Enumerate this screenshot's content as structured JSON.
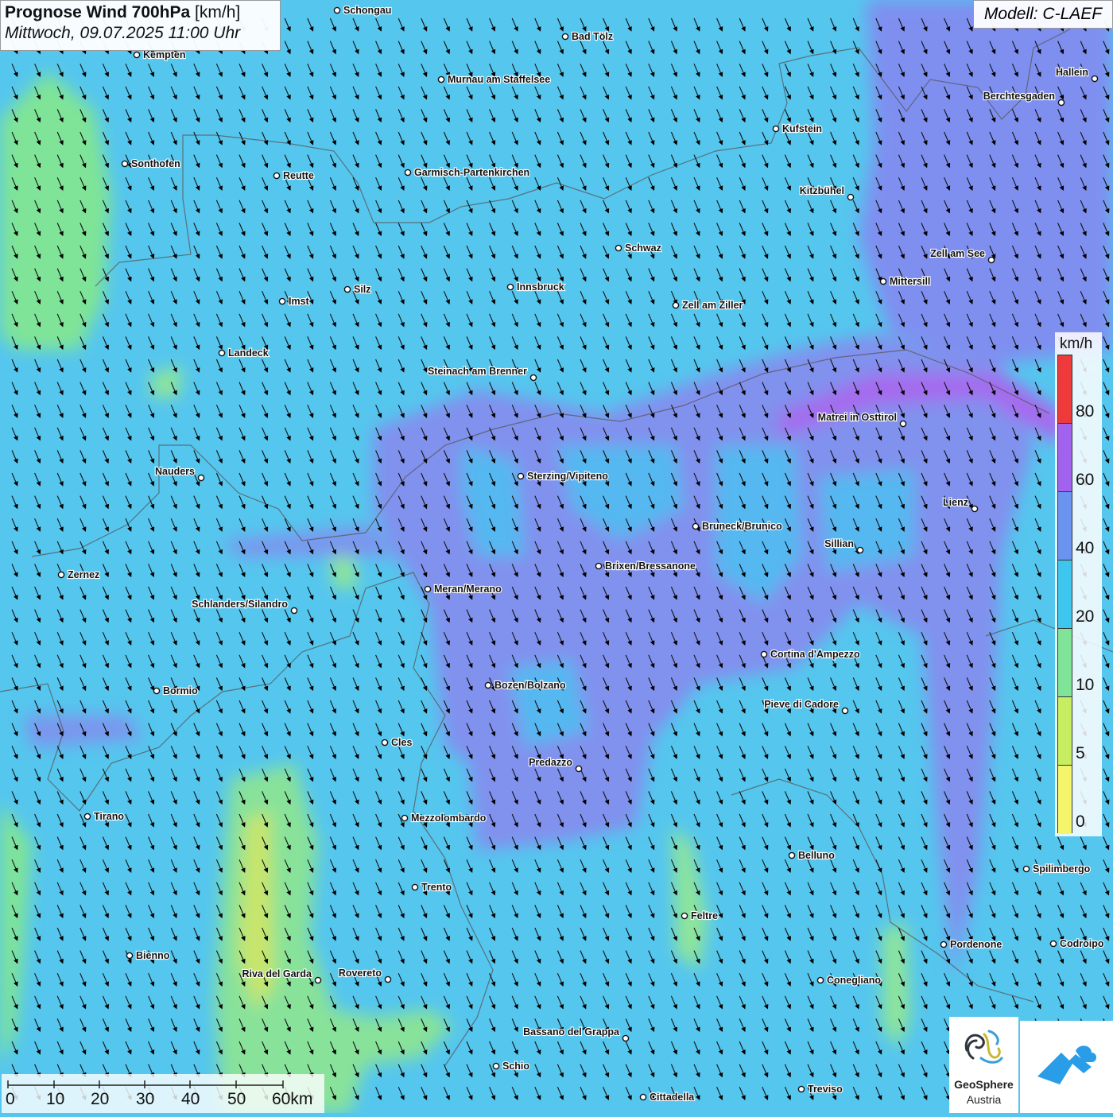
{
  "title": {
    "bold": "Prognose Wind 700hPa",
    "unit": "[km/h]",
    "datetime": "Mittwoch, 09.07.2025 11:00 Uhr"
  },
  "model": "Modell: C-LAEF",
  "legend": {
    "unit": "km/h",
    "entries": [
      {
        "label": "80",
        "color": "#ee3a3a"
      },
      {
        "label": "60",
        "color": "#a163ee"
      },
      {
        "label": "40",
        "color": "#6b93f0"
      },
      {
        "label": "20",
        "color": "#3ec6ee"
      },
      {
        "label": "10",
        "color": "#7fe497"
      },
      {
        "label": "5",
        "color": "#c6ee60"
      },
      {
        "label": "0",
        "color": "#f4f56a"
      }
    ]
  },
  "scalebar": {
    "labels": [
      "0",
      "10",
      "20",
      "30",
      "40",
      "50",
      "60km"
    ]
  },
  "logo": {
    "name": "GeoSphere",
    "sub": "Austria",
    "icon": "geosphere-logo-icon",
    "icon2": "mountain-cloud-logo-icon"
  },
  "wind": {
    "direction": "north-northwest (arrows point south-southeast)",
    "arrow_icon": "wind-arrow-icon"
  },
  "cities": [
    {
      "name": "Schongau"
    },
    {
      "name": "Bad Tölz"
    },
    {
      "name": "Kempten"
    },
    {
      "name": "Murnau am Staffelsee"
    },
    {
      "name": "Hallein"
    },
    {
      "name": "Berchtesgaden"
    },
    {
      "name": "Kufstein"
    },
    {
      "name": "Sonthofen"
    },
    {
      "name": "Reutte"
    },
    {
      "name": "Garmisch-Partenkirchen"
    },
    {
      "name": "Kitzbühel"
    },
    {
      "name": "Schwaz"
    },
    {
      "name": "Zell am See"
    },
    {
      "name": "Mittersill"
    },
    {
      "name": "Innsbruck"
    },
    {
      "name": "Silz"
    },
    {
      "name": "Imst"
    },
    {
      "name": "Zell am Ziller"
    },
    {
      "name": "Landeck"
    },
    {
      "name": "Steinach am Brenner"
    },
    {
      "name": "Matrei in Osttirol"
    },
    {
      "name": "Nauders"
    },
    {
      "name": "Sterzing/Vipiteno"
    },
    {
      "name": "Lienz"
    },
    {
      "name": "Bruneck/Brunico"
    },
    {
      "name": "Sillian"
    },
    {
      "name": "Brixen/Bressanone"
    },
    {
      "name": "Zernez"
    },
    {
      "name": "Meran/Merano"
    },
    {
      "name": "Schlanders/Silandro"
    },
    {
      "name": "Cortina d'Ampezzo"
    },
    {
      "name": "Bozen/Bolzano"
    },
    {
      "name": "Bormio"
    },
    {
      "name": "Pieve di Cadore"
    },
    {
      "name": "Cles"
    },
    {
      "name": "Predazzo"
    },
    {
      "name": "Tirano"
    },
    {
      "name": "Mezzolombardo"
    },
    {
      "name": "Belluno"
    },
    {
      "name": "Spilimbergo"
    },
    {
      "name": "Trento"
    },
    {
      "name": "Feltre"
    },
    {
      "name": "Pordenone"
    },
    {
      "name": "Codroipo"
    },
    {
      "name": "Bienno"
    },
    {
      "name": "Riva del Garda"
    },
    {
      "name": "Rovereto"
    },
    {
      "name": "Conegliano"
    },
    {
      "name": "Bassano del Grappa"
    },
    {
      "name": "Schio"
    },
    {
      "name": "Treviso"
    },
    {
      "name": "Cittadella"
    }
  ]
}
